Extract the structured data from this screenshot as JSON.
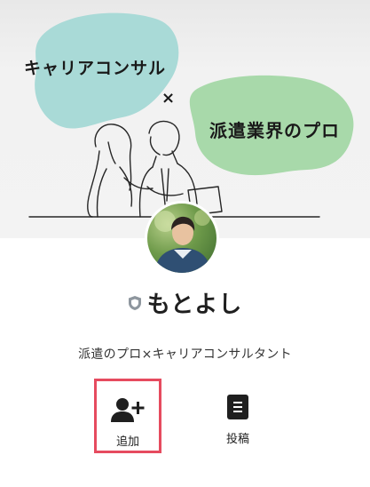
{
  "cover": {
    "left_text": "キャリアコンサル",
    "cross": "×",
    "right_text": "派遣業界のプロ"
  },
  "profile": {
    "name": "もとよし",
    "bio": "派遣のプロ×キャリアコンサルタント"
  },
  "actions": [
    {
      "label": "追加",
      "icon": "add-friend-icon",
      "highlighted": true
    },
    {
      "label": "投稿",
      "icon": "post-document-icon",
      "highlighted": false
    }
  ],
  "colors": {
    "blob_left": "#a9dad7",
    "blob_right": "#a8d9aa",
    "highlight_border": "#e64b5f"
  }
}
